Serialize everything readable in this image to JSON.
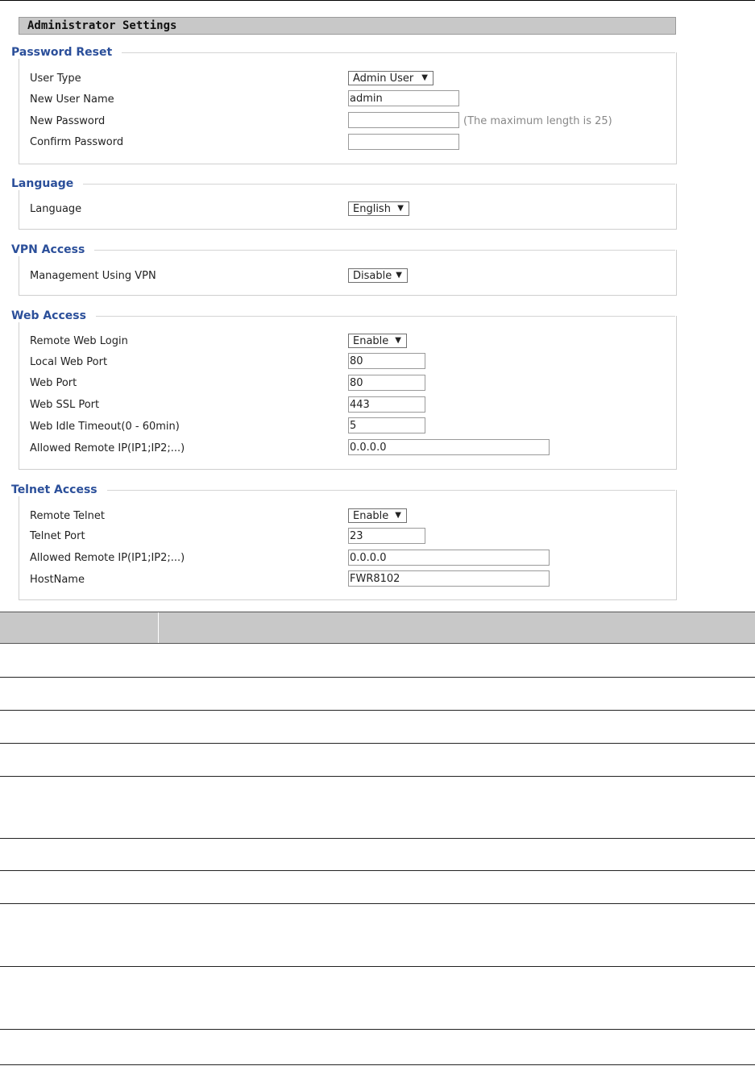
{
  "page": {
    "header": "Administrator Settings"
  },
  "password_reset": {
    "title": "Password Reset",
    "user_type": {
      "label": "User Type",
      "value": "Admin User"
    },
    "new_user_name": {
      "label": "New User Name",
      "value": "admin"
    },
    "new_password": {
      "label": "New Password",
      "value": "",
      "hint": "(The maximum length is 25)"
    },
    "confirm_password": {
      "label": "Confirm Password",
      "value": ""
    }
  },
  "language": {
    "title": "Language",
    "language": {
      "label": "Language",
      "value": "English"
    }
  },
  "vpn_access": {
    "title": "VPN Access",
    "management_using_vpn": {
      "label": "Management Using VPN",
      "value": "Disable"
    }
  },
  "web_access": {
    "title": "Web Access",
    "remote_web_login": {
      "label": "Remote Web Login",
      "value": "Enable"
    },
    "local_web_port": {
      "label": "Local Web Port",
      "value": "80"
    },
    "web_port": {
      "label": "Web Port",
      "value": "80"
    },
    "web_ssl_port": {
      "label": "Web SSL Port",
      "value": "443"
    },
    "web_idle_timeout": {
      "label": "Web Idle Timeout(0 - 60min)",
      "value": "5"
    },
    "allowed_remote_ip": {
      "label": "Allowed Remote IP(IP1;IP2;...)",
      "value": "0.0.0.0"
    }
  },
  "telnet_access": {
    "title": "Telnet Access",
    "remote_telnet": {
      "label": "Remote Telnet",
      "value": "Enable"
    },
    "telnet_port": {
      "label": "Telnet Port",
      "value": "23"
    },
    "allowed_remote_ip": {
      "label": "Allowed Remote IP(IP1;IP2;...)",
      "value": "0.0.0.0"
    },
    "hostname": {
      "label": "HostName",
      "value": "FWR8102"
    }
  },
  "icons": {
    "dropdown_arrow": "▼"
  },
  "colors": {
    "section_title": "#2b4f9a",
    "header_bg": "#c8c8c8",
    "hint": "#888888"
  }
}
